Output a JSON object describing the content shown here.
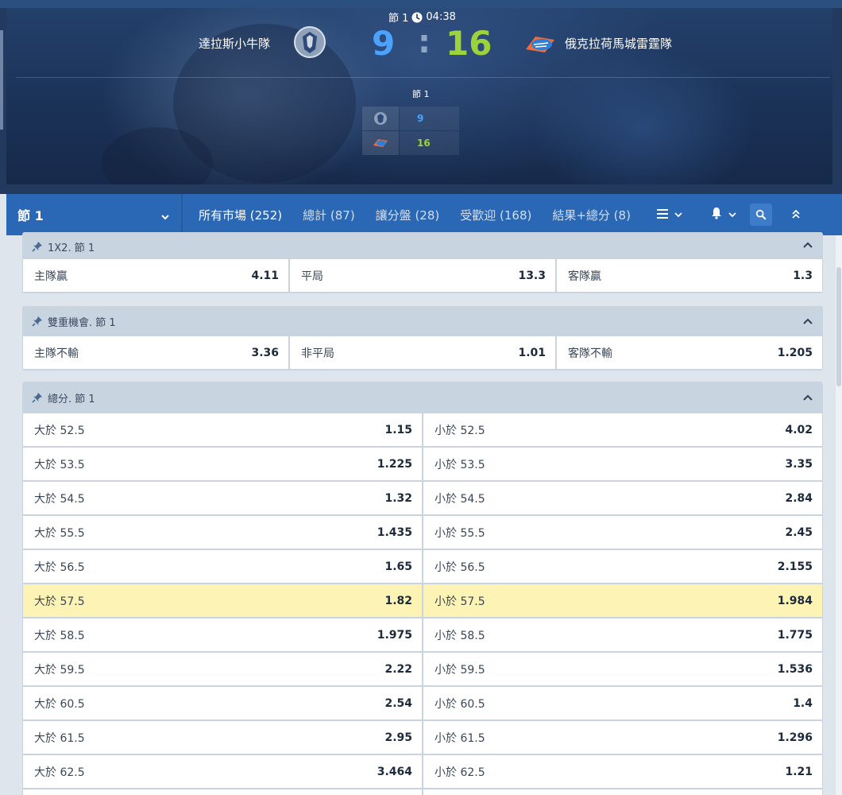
{
  "scoreboard": {
    "period": "節 1",
    "clock": "04:38",
    "home_team": "達拉斯小牛隊",
    "away_team": "俄克拉荷馬城雷霆隊",
    "home_score": "9",
    "separator": ":",
    "away_score": "16",
    "breakdown_label": "節 1",
    "breakdown": [
      {
        "team_icon": "mavericks-logo",
        "score": "9",
        "color": "#4ba3ff"
      },
      {
        "team_icon": "thunder-logo",
        "score": "16",
        "color": "#9cd23c"
      }
    ]
  },
  "nav": {
    "period_select": "節 1",
    "tabs": [
      {
        "label": "所有市場 (252)",
        "active": true
      },
      {
        "label": "總計 (87)",
        "active": false
      },
      {
        "label": "讓分盤 (28)",
        "active": false
      },
      {
        "label": "受歡迎 (168)",
        "active": false
      },
      {
        "label": "結果+總分 (8)",
        "active": false
      }
    ],
    "icons": [
      "list-icon",
      "chevron-down-icon",
      "bell-icon",
      "chevron-down-icon",
      "search-icon",
      "double-chevron-up-icon"
    ]
  },
  "markets": {
    "m1x2": {
      "title": "1X2. 節 1",
      "cells": [
        {
          "label": "主隊贏",
          "odd": "4.11"
        },
        {
          "label": "平局",
          "odd": "13.3"
        },
        {
          "label": "客隊贏",
          "odd": "1.3"
        }
      ]
    },
    "double_chance": {
      "title": "雙重機會. 節 1",
      "cells": [
        {
          "label": "主隊不輸",
          "odd": "3.36"
        },
        {
          "label": "非平局",
          "odd": "1.01"
        },
        {
          "label": "客隊不輸",
          "odd": "1.205"
        }
      ]
    },
    "totals": {
      "title": "總分. 節 1",
      "rows": [
        {
          "over_label": "大於 52.5",
          "over_odd": "1.15",
          "under_label": "小於 52.5",
          "under_odd": "4.02"
        },
        {
          "over_label": "大於 53.5",
          "over_odd": "1.225",
          "under_label": "小於 53.5",
          "under_odd": "3.35"
        },
        {
          "over_label": "大於 54.5",
          "over_odd": "1.32",
          "under_label": "小於 54.5",
          "under_odd": "2.84"
        },
        {
          "over_label": "大於 55.5",
          "over_odd": "1.435",
          "under_label": "小於 55.5",
          "under_odd": "2.45"
        },
        {
          "over_label": "大於 56.5",
          "over_odd": "1.65",
          "under_label": "小於 56.5",
          "under_odd": "2.155"
        },
        {
          "over_label": "大於 57.5",
          "over_odd": "1.82",
          "under_label": "小於 57.5",
          "under_odd": "1.984",
          "highlight": true
        },
        {
          "over_label": "大於 58.5",
          "over_odd": "1.975",
          "under_label": "小於 58.5",
          "under_odd": "1.775"
        },
        {
          "over_label": "大於 59.5",
          "over_odd": "2.22",
          "under_label": "小於 59.5",
          "under_odd": "1.536"
        },
        {
          "over_label": "大於 60.5",
          "over_odd": "2.54",
          "under_label": "小於 60.5",
          "under_odd": "1.4"
        },
        {
          "over_label": "大於 61.5",
          "over_odd": "2.95",
          "under_label": "小於 61.5",
          "under_odd": "1.296"
        },
        {
          "over_label": "大於 62.5",
          "over_odd": "3.464",
          "under_label": "小於 62.5",
          "under_odd": "1.21"
        }
      ]
    }
  },
  "colors": {
    "home_score": "#4ba3ff",
    "away_score": "#9cd23c",
    "nav_bg": "#2a67b4",
    "tab_underline": "#9cd23c",
    "highlight_row": "#fdf3b5"
  }
}
